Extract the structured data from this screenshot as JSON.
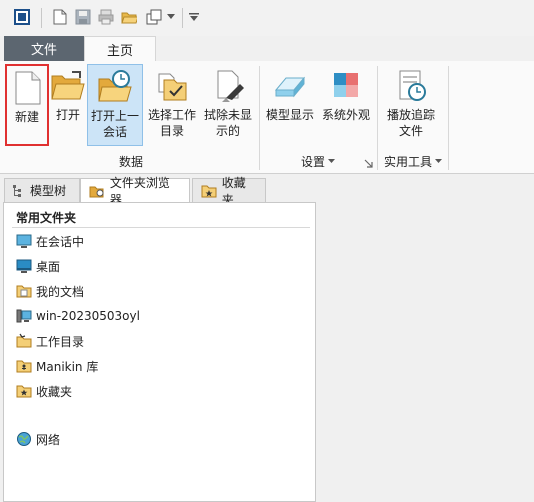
{
  "ribbon_tabs": {
    "file": "文件",
    "home": "主页"
  },
  "buttons": {
    "new": "新建",
    "open": "打开",
    "open_last_1": "打开上一",
    "open_last_2": "会话",
    "select_dir_1": "选择工作",
    "select_dir_2": "目录",
    "erase_1": "拭除未显",
    "erase_2": "示的",
    "model_display": "模型显示",
    "system_appearance": "系统外观",
    "playback_1": "播放追踪",
    "playback_2": "文件"
  },
  "groups": {
    "data": "数据",
    "settings": "设置",
    "utilities": "实用工具"
  },
  "nav_tabs": {
    "model_tree": "模型树",
    "folder_browser": "文件夹浏览器",
    "favorites": "收藏夹"
  },
  "folders": {
    "title": "常用文件夹",
    "items": [
      "在会话中",
      "桌面",
      "我的文档",
      "win-20230503oyl",
      "工作目录",
      "Manikin 库",
      "收藏夹"
    ],
    "network": "网络"
  },
  "colors": {
    "file_tab": "#5c6670",
    "highlight": "#e03030",
    "selected_button": "#cce4f7"
  }
}
